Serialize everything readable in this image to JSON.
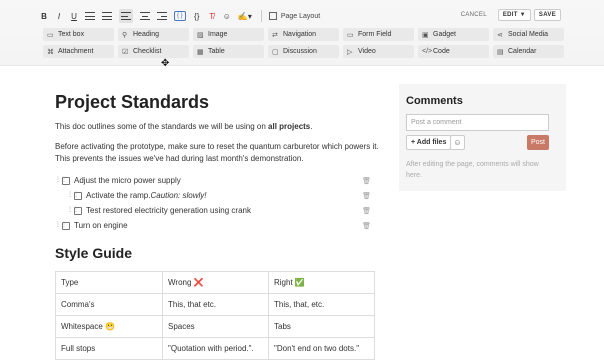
{
  "toolbar": {
    "format": {
      "bold": "B",
      "italic": "I",
      "underline": "U",
      "code": "{ }",
      "code2": "{}",
      "clear": "T̸",
      "emoji": "☺",
      "ink": "✍▾"
    },
    "page_layout": "Page Layout",
    "cancel": "CANCEL",
    "edit": "EDIT ▼",
    "save": "SAVE",
    "insert_items": [
      {
        "icon": "▭",
        "label": "Text box"
      },
      {
        "icon": "⚲",
        "label": "Heading"
      },
      {
        "icon": "▨",
        "label": "Image"
      },
      {
        "icon": "⇄",
        "label": "Navigation"
      },
      {
        "icon": "▭",
        "label": "Form Field"
      },
      {
        "icon": "▣",
        "label": "Gadget"
      },
      {
        "icon": "⋖",
        "label": "Social Media"
      },
      {
        "icon": "⌘",
        "label": "Attachment"
      },
      {
        "icon": "☑",
        "label": "Checklist"
      },
      {
        "icon": "▦",
        "label": "Table"
      },
      {
        "icon": "▢",
        "label": "Discussion"
      },
      {
        "icon": "▷",
        "label": "Video"
      },
      {
        "icon": "</>",
        "label": "Code"
      },
      {
        "icon": "▤",
        "label": "Calendar"
      }
    ]
  },
  "doc": {
    "title": "Project Standards",
    "intro_pre": "This doc outlines some of the standards we will be using on ",
    "intro_bold": "all projects",
    "intro_post": ".",
    "para2": "Before activating the prototype, make sure to reset the quantum carburetor which powers it. This prevents the issues we've had during last month's demonstration.",
    "tasks": [
      {
        "text": "Adjust the micro power supply",
        "level": 0
      },
      {
        "text": "Activate the ramp. ",
        "italic": "Caution: slowly!",
        "level": 1
      },
      {
        "text": "Test restored electricity generation using crank",
        "level": 1
      },
      {
        "text": "Turn on engine",
        "level": 0
      }
    ],
    "style_heading": "Style Guide",
    "table": [
      [
        "Type",
        "Wrong ❌",
        "Right ✅"
      ],
      [
        "Comma's",
        "This, that etc.",
        "This, that, etc."
      ],
      [
        "Whitespace 😬",
        "Spaces",
        "Tabs"
      ],
      [
        "Full stops",
        "\"Quotation with period.\".",
        "\"Don't end on two dots.\""
      ]
    ]
  },
  "comments": {
    "title": "Comments",
    "placeholder": "Post a comment",
    "add_files": "+ Add files",
    "emoji": "☺",
    "post": "Post",
    "hint": "After editing the page, comments will show here."
  }
}
